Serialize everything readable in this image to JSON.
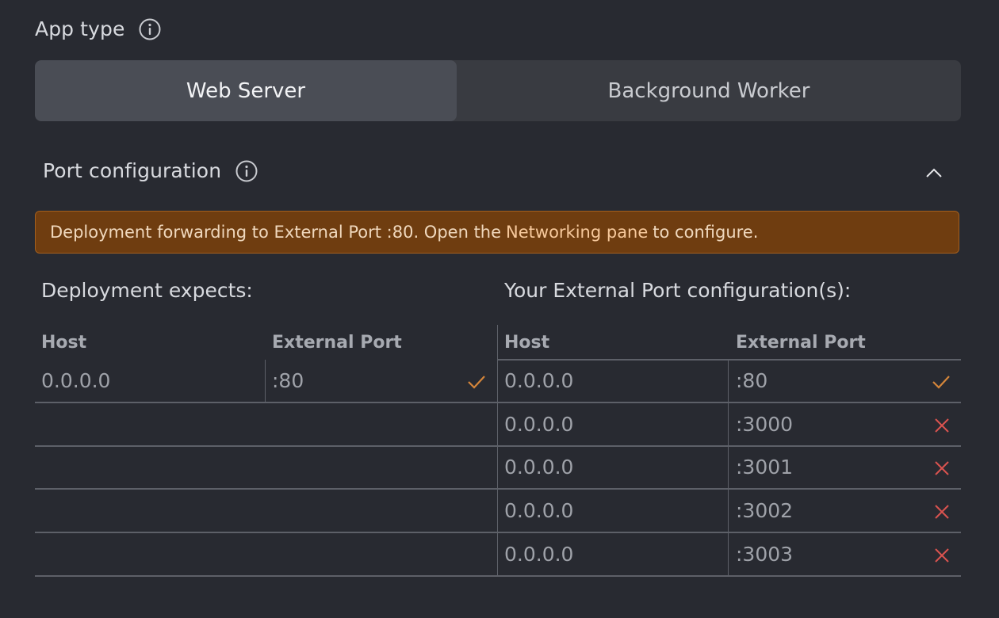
{
  "app_type": {
    "label": "App type",
    "info_icon": "info-icon",
    "options": [
      {
        "label": "Web Server",
        "active": true
      },
      {
        "label": "Background Worker",
        "active": false
      }
    ]
  },
  "port_config": {
    "label": "Port configuration",
    "info_icon": "info-icon",
    "collapse_icon": "chevron-up-icon",
    "banner": {
      "prefix": "Deployment forwarding to External Port :80. Open the",
      "link": "Networking pane",
      "suffix": "to configure."
    },
    "expects": {
      "title": "Deployment expects:",
      "headers": [
        "Host",
        "External Port"
      ],
      "rows": [
        {
          "host": "0.0.0.0",
          "port": ":80",
          "status": "check-icon"
        }
      ]
    },
    "external": {
      "title": "Your External Port configuration(s):",
      "headers": [
        "Host",
        "External Port"
      ],
      "rows": [
        {
          "host": "0.0.0.0",
          "port": ":80",
          "status": "check-icon"
        },
        {
          "host": "0.0.0.0",
          "port": ":3000",
          "status": "x-icon"
        },
        {
          "host": "0.0.0.0",
          "port": ":3001",
          "status": "x-icon"
        },
        {
          "host": "0.0.0.0",
          "port": ":3002",
          "status": "x-icon"
        },
        {
          "host": "0.0.0.0",
          "port": ":3003",
          "status": "x-icon"
        }
      ]
    }
  },
  "colors": {
    "background": "#282a31",
    "accent_orange": "#d4853a",
    "error_red": "#d9534f",
    "banner_bg": "#6f3d10"
  }
}
